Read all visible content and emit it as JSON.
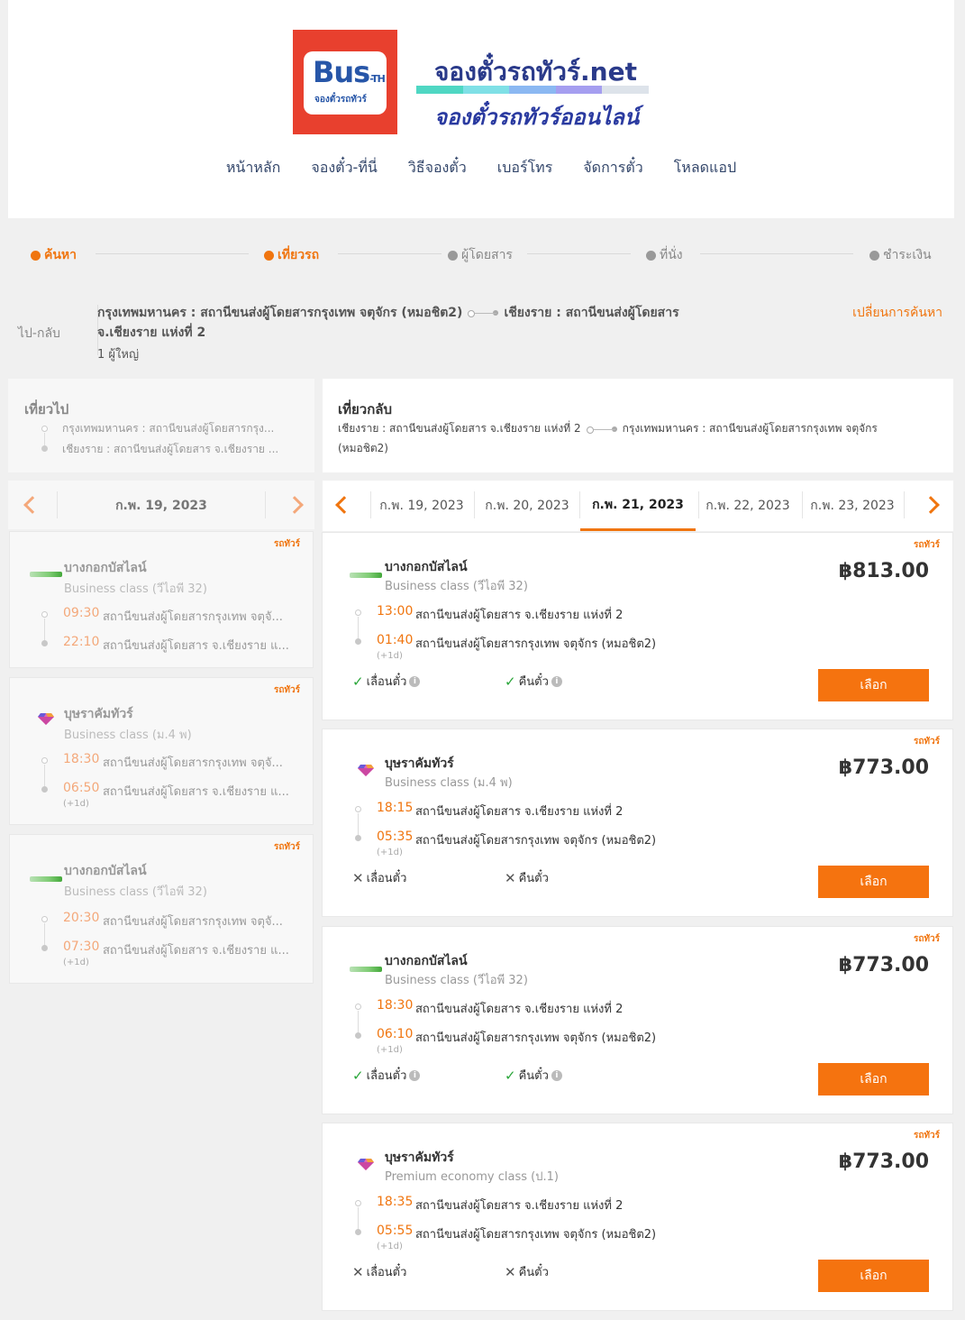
{
  "header": {
    "logo_main": "Bus",
    "logo_th": "-TH",
    "logo_sub": "จองตั๋วรถทัวร์",
    "brand_title": "จองตั๋วรถทัวร์.net",
    "brand_tagline": "จองตั๋วรถทัวร์ออนไลน์",
    "brand_colors": [
      "#4fd7c3",
      "#7fe0e6",
      "#8bb8f2",
      "#a59ef0",
      "#dde3ea"
    ],
    "nav": [
      "หน้าหลัก",
      "จองตั๋ว-ที่นี่",
      "วิธีจองตั๋ว",
      "เบอร์โทร",
      "จัดการตั๋ว",
      "โหลดแอป"
    ]
  },
  "steps": [
    {
      "label": "ค้นหา",
      "active": true
    },
    {
      "label": "เที่ยวรถ",
      "active": true
    },
    {
      "label": "ผู้โดยสาร",
      "active": false
    },
    {
      "label": "ที่นั่ง",
      "active": false
    },
    {
      "label": "ชำระเงิน",
      "active": false
    }
  ],
  "route": {
    "trip_type": "ไป-กลับ",
    "origin": "กรุงเทพมหานคร : สถานีขนส่งผู้โดยสารกรุงเทพ จตุจักร (หมอชิต2)",
    "destination_a": "เชียงราย : สถานีขนส่งผู้โดยสาร",
    "destination_b": "จ.เชียงราย แห่งที่ 2",
    "passengers": "1 ผู้ใหญ่",
    "change_search": "เปลี่ยนการค้นหา"
  },
  "outbound": {
    "title": "เที่ยวไป",
    "from": "กรุงเทพมหานคร : สถานีขนส่งผู้โดยสารกรุง...",
    "to": "เชียงราย : สถานีขนส่งผู้โดยสาร จ.เชียงราย ...",
    "date": "ก.พ. 19, 2023",
    "trips": [
      {
        "tag": "รถทัวร์",
        "operator": "บางกอกบัสไลน์",
        "class": "Business class (วีไอพี 32)",
        "dep_time": "09:30",
        "dep_stop": "สถานีขนส่งผู้โดยสารกรุงเทพ จตุจั...",
        "arr_time": "22:10",
        "arr_stop": "สถานีขนส่งผู้โดยสาร จ.เชียงราย แ...",
        "next_day": ""
      },
      {
        "tag": "รถทัวร์",
        "operator": "บุษราคัมทัวร์",
        "class": "Business class (ม.4 พ)",
        "dep_time": "18:30",
        "dep_stop": "สถานีขนส่งผู้โดยสารกรุงเทพ จตุจั...",
        "arr_time": "06:50",
        "arr_stop": "สถานีขนส่งผู้โดยสาร จ.เชียงราย แ...",
        "next_day": "(+1d)"
      },
      {
        "tag": "รถทัวร์",
        "operator": "บางกอกบัสไลน์",
        "class": "Business class (วีไอพี 32)",
        "dep_time": "20:30",
        "dep_stop": "สถานีขนส่งผู้โดยสารกรุงเทพ จตุจั...",
        "arr_time": "07:30",
        "arr_stop": "สถานีขนส่งผู้โดยสาร จ.เชียงราย แ...",
        "next_day": "(+1d)"
      }
    ]
  },
  "return": {
    "title": "เที่ยวกลับ",
    "from": "เชียงราย : สถานีขนส่งผู้โดยสาร จ.เชียงราย แห่งที่ 2",
    "to_a": "กรุงเทพมหานคร : สถานีขนส่งผู้โดยสารกรุงเทพ จตุจักร",
    "to_b": "(หมอชิต2)",
    "dates": [
      "ก.พ. 19, 2023",
      "ก.พ. 20, 2023",
      "ก.พ. 21, 2023",
      "ก.พ. 22, 2023",
      "ก.พ. 23, 2023"
    ],
    "active_date_index": 2,
    "trips": [
      {
        "tag": "รถทัวร์",
        "operator": "บางกอกบัสไลน์",
        "class": "Business class (วีไอพี 32)",
        "dep_time": "13:00",
        "dep_stop": "สถานีขนส่งผู้โดยสาร จ.เชียงราย แห่งที่ 2",
        "arr_time": "01:40",
        "arr_stop": "สถานีขนส่งผู้โดยสารกรุงเทพ จตุจักร (หมอชิต2)",
        "next_day": "(+1d)",
        "price": "฿813.00",
        "reschedule": "เลื่อนตั๋ว",
        "refund": "คืนตั๋ว",
        "reschedule_ok": true,
        "refund_ok": true,
        "select": "เลือก"
      },
      {
        "tag": "รถทัวร์",
        "operator": "บุษราคัมทัวร์",
        "class": "Business class (ม.4 พ)",
        "dep_time": "18:15",
        "dep_stop": "สถานีขนส่งผู้โดยสาร จ.เชียงราย แห่งที่ 2",
        "arr_time": "05:35",
        "arr_stop": "สถานีขนส่งผู้โดยสารกรุงเทพ จตุจักร (หมอชิต2)",
        "next_day": "(+1d)",
        "price": "฿773.00",
        "reschedule": "เลื่อนตั๋ว",
        "refund": "คืนตั๋ว",
        "reschedule_ok": false,
        "refund_ok": false,
        "select": "เลือก"
      },
      {
        "tag": "รถทัวร์",
        "operator": "บางกอกบัสไลน์",
        "class": "Business class (วีไอพี 32)",
        "dep_time": "18:30",
        "dep_stop": "สถานีขนส่งผู้โดยสาร จ.เชียงราย แห่งที่ 2",
        "arr_time": "06:10",
        "arr_stop": "สถานีขนส่งผู้โดยสารกรุงเทพ จตุจักร (หมอชิต2)",
        "next_day": "(+1d)",
        "price": "฿773.00",
        "reschedule": "เลื่อนตั๋ว",
        "refund": "คืนตั๋ว",
        "reschedule_ok": true,
        "refund_ok": true,
        "select": "เลือก"
      },
      {
        "tag": "รถทัวร์",
        "operator": "บุษราคัมทัวร์",
        "class": "Premium economy class (ป.1)",
        "dep_time": "18:35",
        "dep_stop": "สถานีขนส่งผู้โดยสาร จ.เชียงราย แห่งที่ 2",
        "arr_time": "05:55",
        "arr_stop": "สถานีขนส่งผู้โดยสารกรุงเทพ จตุจักร (หมอชิต2)",
        "next_day": "(+1d)",
        "price": "฿773.00",
        "reschedule": "เลื่อนตั๋ว",
        "refund": "คืนตั๋ว",
        "reschedule_ok": false,
        "refund_ok": false,
        "select": "เลือก"
      }
    ]
  },
  "colors": {
    "accent": "#f5730f",
    "ok": "#2aa63a"
  }
}
